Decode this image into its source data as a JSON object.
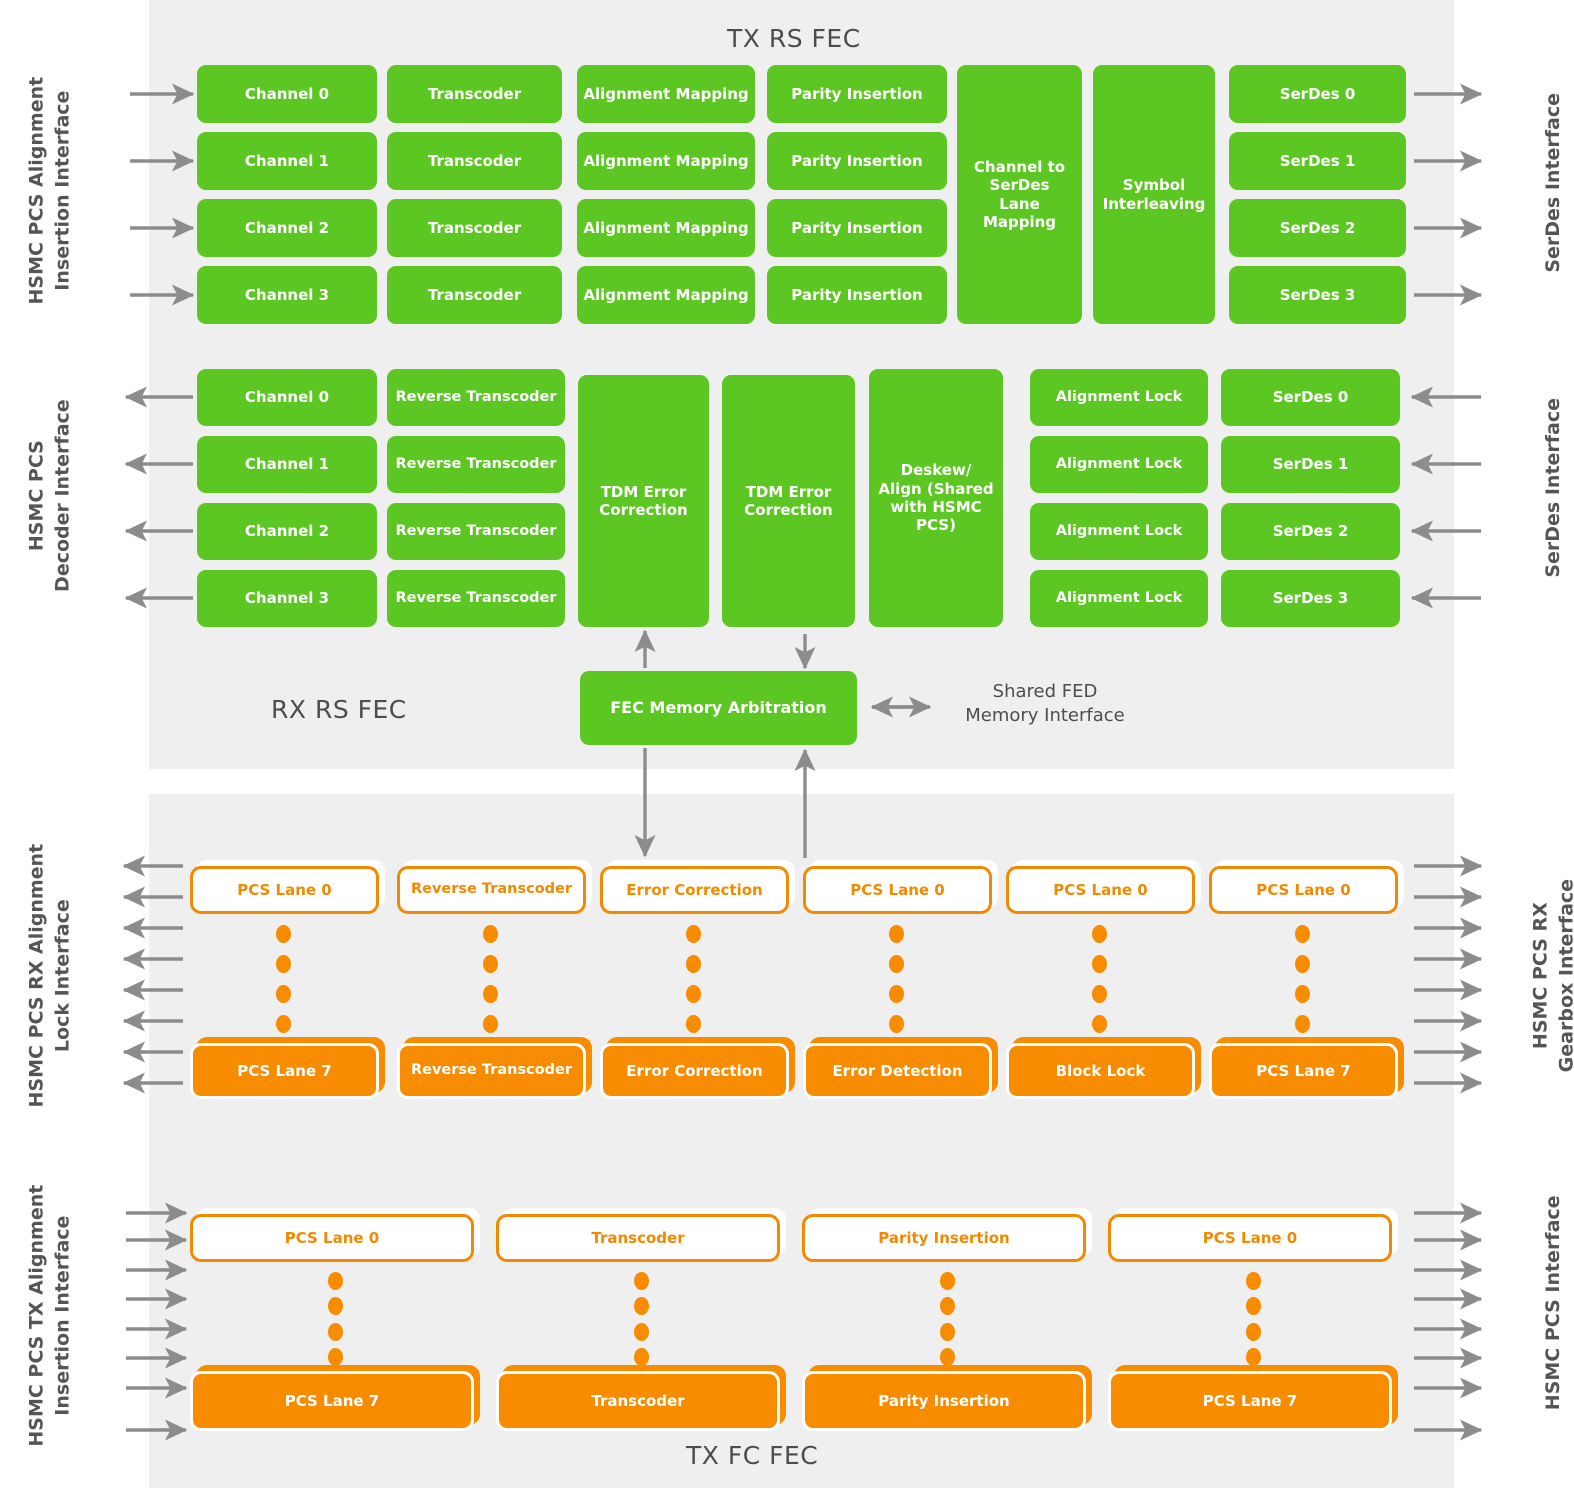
{
  "colors": {
    "green": "#5cc722",
    "orange": "#f78c00",
    "orange_outline": "#f18a00",
    "panel_bg": "#efefef",
    "arrow": "#8c8c8c",
    "title_text": "#4d4d4d",
    "label_text": "#555555"
  },
  "sections": {
    "tx_rs_fec": {
      "title": "TX RS FEC",
      "left_label": "HSMC PCS Alignment\nInsertion Interface",
      "right_label": "SerDes Interface",
      "columns": {
        "channels": [
          "Channel 0",
          "Channel 1",
          "Channel 2",
          "Channel 3"
        ],
        "transcoders": [
          "Transcoder",
          "Transcoder",
          "Transcoder",
          "Transcoder"
        ],
        "alignment_mapping": [
          "Alignment Mapping",
          "Alignment Mapping",
          "Alignment Mapping",
          "Alignment Mapping"
        ],
        "parity_insertion": [
          "Parity Insertion",
          "Parity Insertion",
          "Parity Insertion",
          "Parity Insertion"
        ],
        "lane_mapping": "Channel to SerDes Lane Mapping",
        "symbol_interleaving": "Symbol Interleaving",
        "serdes": [
          "SerDes 0",
          "SerDes 1",
          "SerDes 2",
          "SerDes 3"
        ]
      }
    },
    "rx_rs_fec": {
      "title": "RX RS FEC",
      "left_label": "HSMC PCS\nDecoder Interface",
      "right_label": "SerDes Interface",
      "columns": {
        "channels": [
          "Channel 0",
          "Channel 1",
          "Channel 2",
          "Channel 3"
        ],
        "reverse_transcoders": [
          "Reverse Transcoder",
          "Reverse Transcoder",
          "Reverse Transcoder",
          "Reverse Transcoder"
        ],
        "tdm_error_correction_1": "TDM Error Correction",
        "tdm_error_correction_2": "TDM Error Correction",
        "deskew_align": "Deskew/ Align (Shared with HSMC PCS)",
        "alignment_lock": [
          "Alignment Lock",
          "Alignment Lock",
          "Alignment Lock",
          "Alignment Lock"
        ],
        "serdes": [
          "SerDes 0",
          "SerDes 1",
          "SerDes 2",
          "SerDes 3"
        ]
      },
      "fec_memory_arbitration": "FEC Memory Arbitration",
      "shared_fed_note": "Shared FED\nMemory Interface"
    },
    "rx_fc_fec": {
      "left_label": "HSMC PCS RX Alignment\nLock Interface",
      "right_label": "HSMC PCS RX\nGearbox  Interface",
      "columns": [
        {
          "top": "PCS Lane 0",
          "bottom": "PCS Lane 7"
        },
        {
          "top": "Reverse Transcoder",
          "bottom": "Reverse Transcoder"
        },
        {
          "top": "Error Correction",
          "bottom": "Error Correction"
        },
        {
          "top": "PCS Lane 0",
          "bottom": "Error Detection"
        },
        {
          "top": "PCS Lane 0",
          "bottom": "Block Lock"
        },
        {
          "top": "PCS Lane 0",
          "bottom": "PCS Lane 7"
        }
      ],
      "arrow_count_left": 8,
      "arrow_count_right": 8
    },
    "tx_fc_fec": {
      "title": "TX FC FEC",
      "left_label": "HSMC PCS TX Alignment\nInsertion Interface",
      "right_label": "HSMC PCS Interface",
      "columns": [
        {
          "top": "PCS Lane 0",
          "bottom": "PCS Lane 7"
        },
        {
          "top": "Transcoder",
          "bottom": "Transcoder"
        },
        {
          "top": "Parity Insertion",
          "bottom": "Parity Insertion"
        },
        {
          "top": "PCS Lane 0",
          "bottom": "PCS Lane 7"
        }
      ],
      "arrow_count_left": 8,
      "arrow_count_right": 8
    }
  }
}
